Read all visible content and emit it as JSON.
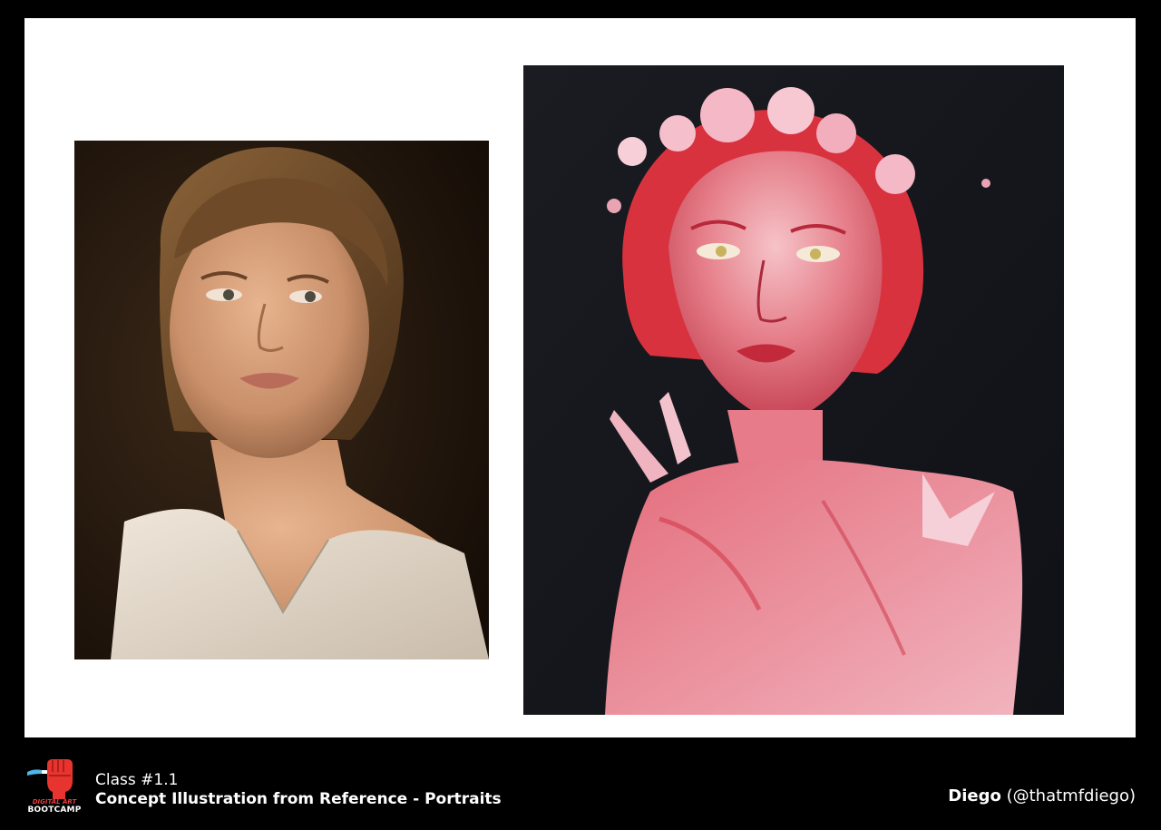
{
  "footer": {
    "logo": {
      "line1": "DIGITAL ART",
      "line2": "BOOTCAMP",
      "icon": "raised-fist-brush-icon",
      "accent_color": "#e83c3c"
    },
    "class_number": "Class #1.1",
    "class_title": "Concept Illustration from Reference - Portraits",
    "artist_name": "Diego",
    "artist_handle": "(@thatmfdiego)"
  },
  "images": {
    "reference": "reference-portrait-photo",
    "painting": "digital-portrait-painting"
  },
  "colors": {
    "background": "#000000",
    "panel": "#ffffff",
    "photo_background": "#1f150d",
    "painting_background": "#16171c",
    "painting_accent": "#e0485a"
  }
}
